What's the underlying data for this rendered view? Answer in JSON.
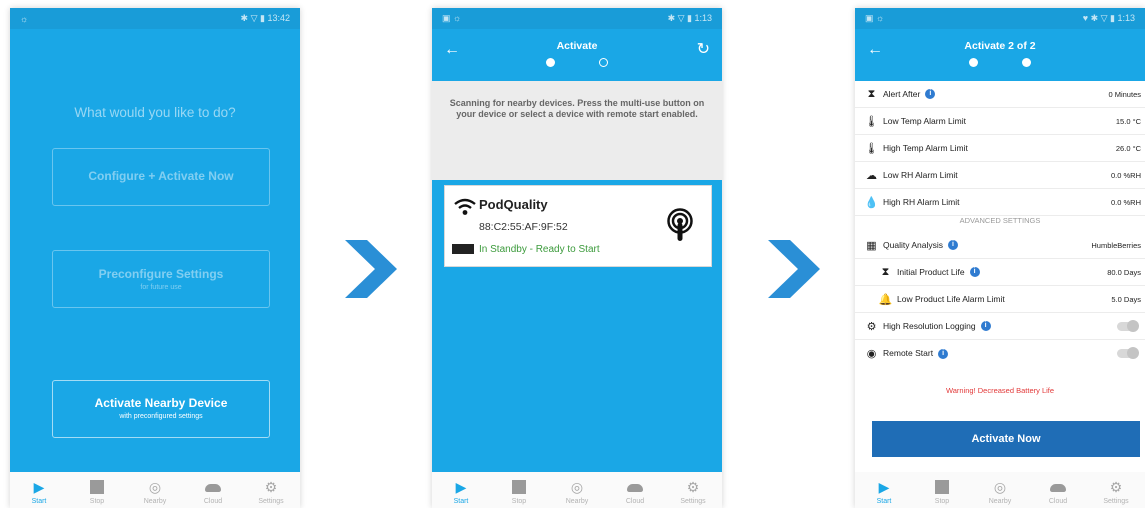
{
  "phone1": {
    "status": {
      "left": "☼",
      "right": "✱ ▽ ▮ 13:42"
    },
    "question": "What would you like to do?",
    "buttons": [
      {
        "main": "Configure + Activate Now",
        "sub": ""
      },
      {
        "main": "Preconfigure Settings",
        "sub": "for future use"
      },
      {
        "main": "Activate Nearby Device",
        "sub": "with preconfigured settings"
      }
    ]
  },
  "phone2": {
    "status": {
      "left": "▣ ☼",
      "right": "✱ ▽ ▮ 1:13"
    },
    "title": "Activate",
    "scan_text": "Scanning for nearby devices. Press the multi-use button on your device or select a device with remote start enabled.",
    "device": {
      "name": "PodQuality",
      "mac": "88:C2:55:AF:9F:52",
      "status": "In Standby - Ready to Start"
    }
  },
  "phone3": {
    "status": {
      "left": "▣ ☼",
      "right": "♥ ✱ ▽ ▮ 1:13"
    },
    "title": "Activate 2 of 2",
    "rows": [
      {
        "icon": "⧗",
        "label": "Alert After",
        "value": "0 Minutes"
      },
      {
        "icon": "🌡",
        "label": "Low Temp Alarm Limit",
        "value": "15.0 °C"
      },
      {
        "icon": "🌡",
        "label": "High Temp Alarm Limit",
        "value": "26.0 °C"
      },
      {
        "icon": "☁",
        "label": "Low RH Alarm Limit",
        "value": "0.0 %RH"
      },
      {
        "icon": "💧",
        "label": "High RH Alarm Limit",
        "value": "0.0 %RH"
      },
      {
        "icon": "▦",
        "label": "Quality Analysis",
        "value": "HumbleBerries"
      },
      {
        "icon": "⧗",
        "label": "Initial Product Life",
        "value": "80.0 Days"
      },
      {
        "icon": "🔔",
        "label": "Low Product Life Alarm Limit",
        "value": "5.0 Days"
      },
      {
        "icon": "⚙",
        "label": "High Resolution Logging",
        "value": ""
      },
      {
        "icon": "◉",
        "label": "Remote Start",
        "value": ""
      }
    ],
    "advanced_label": "ADVANCED SETTINGS",
    "warning": "Warning! Decreased Battery Life",
    "activate_button": "Activate Now"
  },
  "tabs": [
    "Start",
    "Stop",
    "Nearby",
    "Cloud",
    "Settings"
  ],
  "colors": {
    "primary": "#1aa7e6",
    "dark_button": "#1f6db6",
    "chevron": "#2a8fd6",
    "ok_text": "#3d9b3d",
    "warning": "#e23a3a"
  }
}
